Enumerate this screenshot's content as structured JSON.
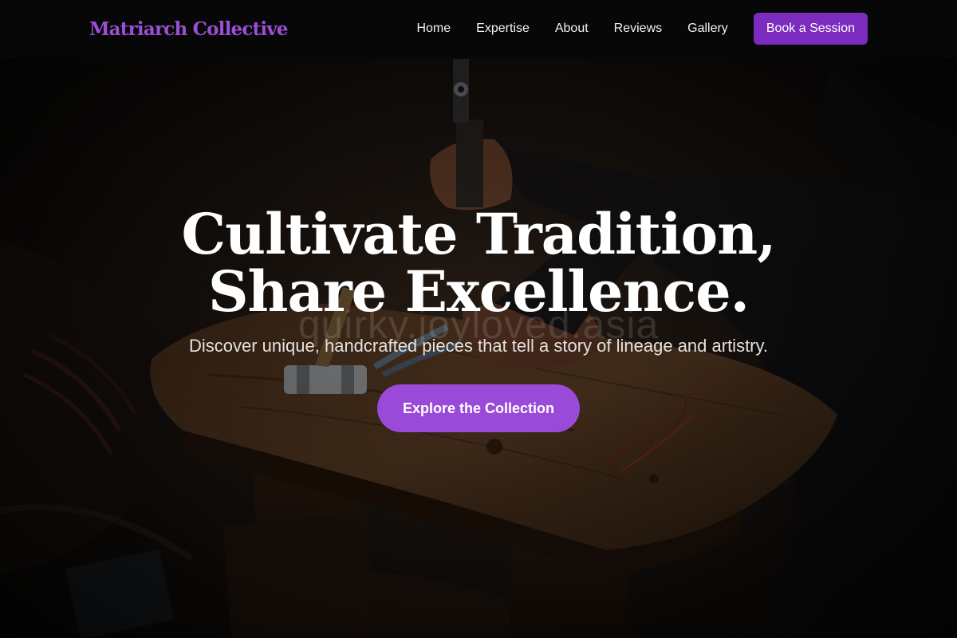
{
  "brand": {
    "name": "Matriarch Collective",
    "color": "#9b4fd6"
  },
  "nav": {
    "links": [
      {
        "label": "Home"
      },
      {
        "label": "Expertise"
      },
      {
        "label": "About"
      },
      {
        "label": "Reviews"
      },
      {
        "label": "Gallery"
      }
    ],
    "cta_label": "Book a Session",
    "cta_color": "#7b2cbf"
  },
  "hero": {
    "title_line1": "Cultivate Tradition,",
    "title_line2": "Share Excellence.",
    "watermark": "quirky.joyloved.asia",
    "subtitle": "Discover unique, handcrafted pieces that tell a story of lineage and artistry.",
    "cta_label": "Explore the Collection",
    "cta_color": "#9a4ad8",
    "background": "artisan hammering on a wooden workbench"
  }
}
